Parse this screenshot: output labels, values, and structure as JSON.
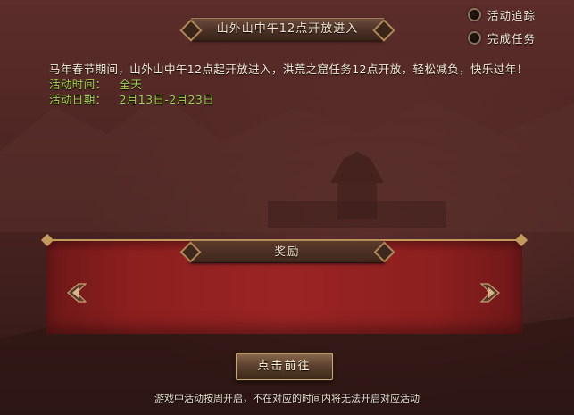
{
  "header": {
    "title": "山外山中午12点开放进入"
  },
  "side_options": [
    {
      "label": "活动追踪"
    },
    {
      "label": "完成任务"
    }
  ],
  "description": {
    "text": "马年春节期间，山外山中午12点起开放进入，洪荒之窟任务12点开放，轻松减负，快乐过年！"
  },
  "event_info": {
    "time_label": "活动时间：",
    "time_value": "全天",
    "date_label": "活动日期：",
    "date_value": "2月13日-2月23日"
  },
  "reward": {
    "title": "奖励"
  },
  "go_button": {
    "label": "点击前往"
  },
  "footnote": "游戏中活动按周开启，不在对应的时间内将无法开启对应活动",
  "colors": {
    "highlight_green": "#9ed450",
    "body_text": "#f4ead8",
    "reward_band": "#9a2424",
    "gold_trim": "#c39a5e"
  }
}
